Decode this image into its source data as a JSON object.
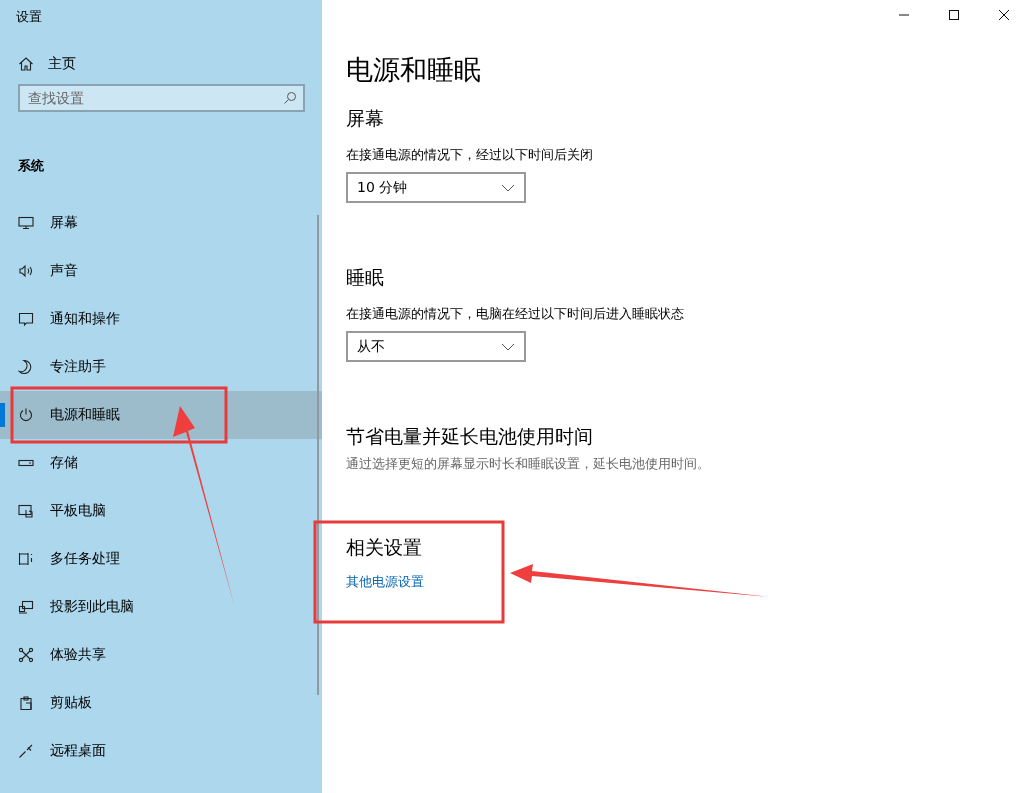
{
  "window": {
    "title": "设置"
  },
  "sidebar": {
    "home": "主页",
    "search": {
      "placeholder": "查找设置"
    },
    "section": "系统",
    "items": [
      {
        "label": "屏幕",
        "selected": false
      },
      {
        "label": "声音",
        "selected": false
      },
      {
        "label": "通知和操作",
        "selected": false
      },
      {
        "label": "专注助手",
        "selected": false
      },
      {
        "label": "电源和睡眠",
        "selected": true
      },
      {
        "label": "存储",
        "selected": false
      },
      {
        "label": "平板电脑",
        "selected": false
      },
      {
        "label": "多任务处理",
        "selected": false
      },
      {
        "label": "投影到此电脑",
        "selected": false
      },
      {
        "label": "体验共享",
        "selected": false
      },
      {
        "label": "剪贴板",
        "selected": false
      },
      {
        "label": "远程桌面",
        "selected": false
      }
    ]
  },
  "page": {
    "title": "电源和睡眠",
    "sections": [
      {
        "kind": "dropdown",
        "heading": "屏幕",
        "label": "在接通电源的情况下，经过以下时间后关闭",
        "value": "10 分钟"
      },
      {
        "kind": "dropdown",
        "heading": "睡眠",
        "label": "在接通电源的情况下，电脑在经过以下时间后进入睡眠状态",
        "value": "从不"
      },
      {
        "kind": "note",
        "heading": "节省电量并延长电池使用时间",
        "text": "通过选择更短的屏幕显示时长和睡眠设置，延长电池使用时间。"
      },
      {
        "kind": "link",
        "heading": "相关设置",
        "link": "其他电源设置"
      }
    ]
  }
}
